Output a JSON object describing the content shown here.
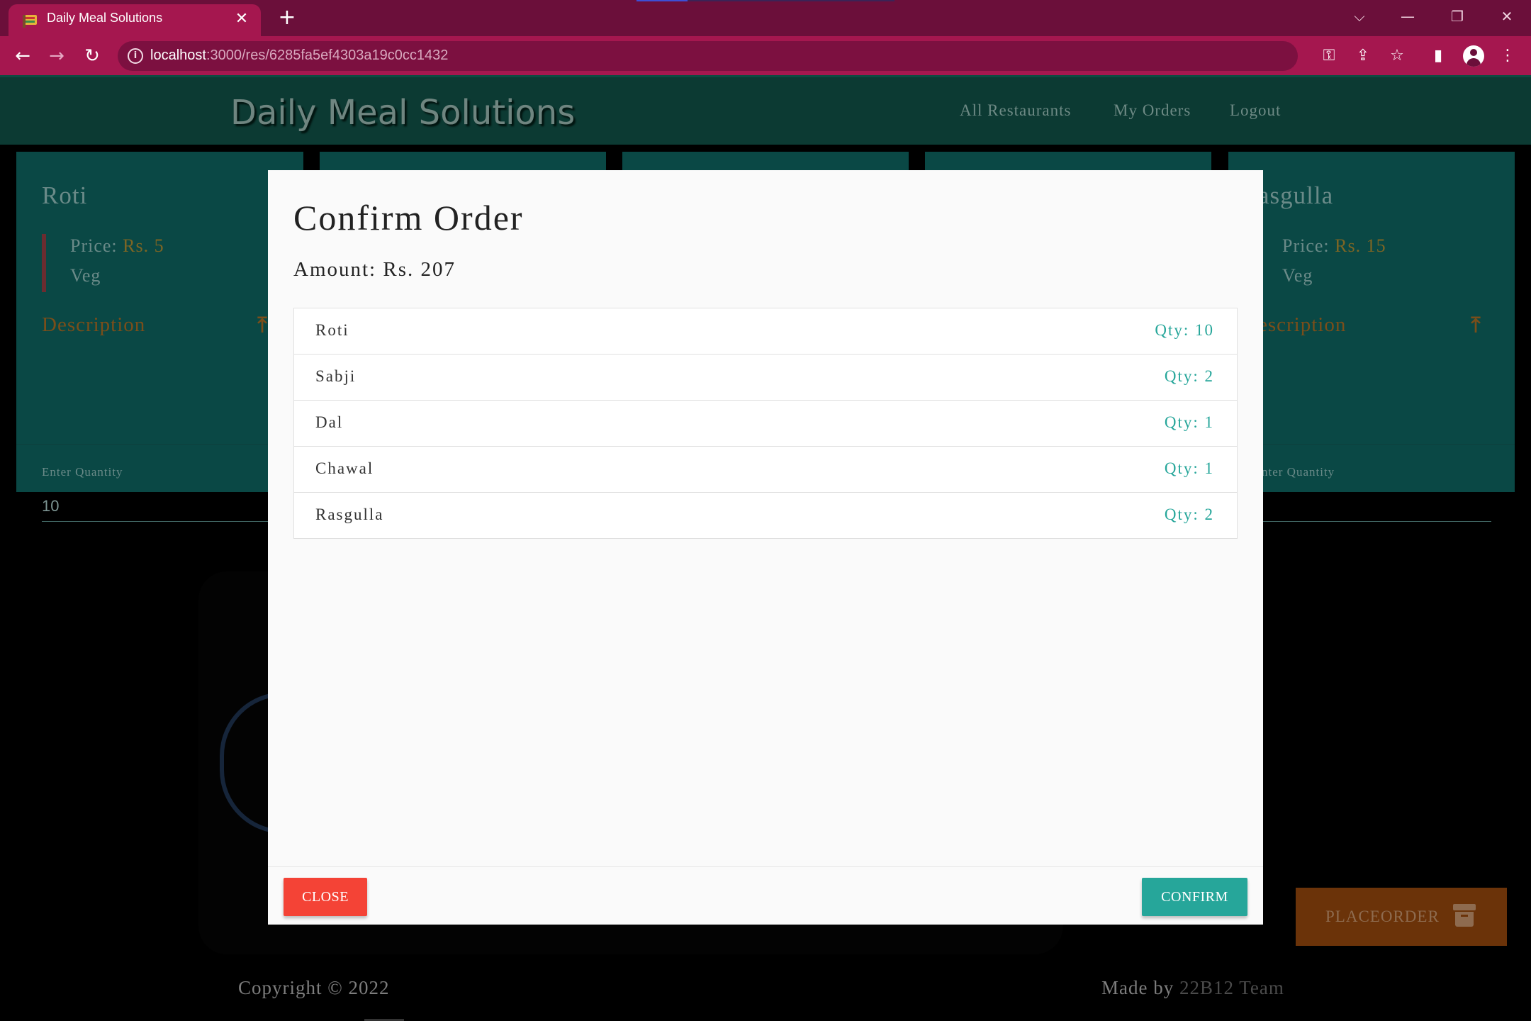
{
  "browser": {
    "tab_title": "Daily Meal Solutions",
    "url_host": "localhost",
    "url_rest": ":3000/res/6285fa5ef4303a19c0cc1432"
  },
  "navbar": {
    "brand": "Daily Meal Solutions",
    "links": [
      "All Restaurants",
      "My Orders",
      "Logout"
    ]
  },
  "cards": [
    {
      "name": "Roti",
      "price_label": "Price:",
      "price_value": "Rs. 5",
      "veg": "Veg",
      "description": "Description",
      "qty_label": "Enter Quantity",
      "qty_value": "10"
    },
    {
      "name": "asgulla",
      "price_label": "Price:",
      "price_value": "Rs. 15",
      "veg": "Veg",
      "description": "escription",
      "qty_label": "nter Quantity",
      "qty_value": ""
    }
  ],
  "modal": {
    "title": "Confirm Order",
    "amount": "Amount: Rs. 207",
    "items": [
      {
        "name": "Roti",
        "qty": "Qty: 10"
      },
      {
        "name": "Sabji",
        "qty": "Qty: 2"
      },
      {
        "name": "Dal",
        "qty": "Qty: 1"
      },
      {
        "name": "Chawal",
        "qty": "Qty: 1"
      },
      {
        "name": "Rasgulla",
        "qty": "Qty: 2"
      }
    ],
    "close_label": "CLOSE",
    "confirm_label": "CONFIRM"
  },
  "placeorder_label": "PLACEORDER",
  "footer": {
    "copyright": "Copyright © 2022",
    "made_by": "Made by ",
    "team": "22B12 Team"
  },
  "colors": {
    "tab_strip": "#6b0f3a",
    "toolbar": "#a5174f",
    "navbar": "#0c3a33",
    "card": "#0a4845",
    "confirm": "#26a69a",
    "close": "#f44336"
  }
}
